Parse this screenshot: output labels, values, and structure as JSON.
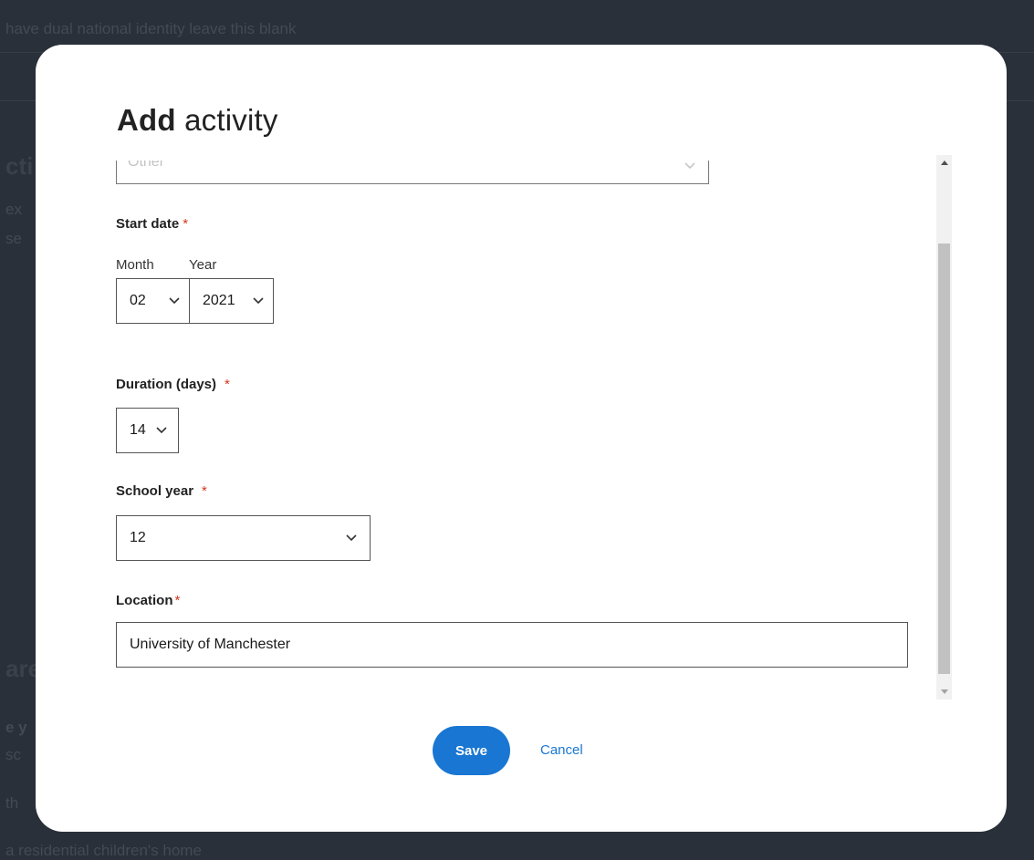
{
  "background": {
    "hint_text": "have dual national identity leave this blank",
    "heading_1": "cti",
    "line_1": "ex",
    "line_2": "se",
    "heading_2": "are",
    "line_3": "e y",
    "line_4": "sc",
    "line_5": "th",
    "line_6": "a residential children's home"
  },
  "modal": {
    "title_bold": "Add",
    "title_rest": " activity",
    "activity_type": {
      "value": "Other"
    },
    "start_date": {
      "label": "Start date",
      "required_marker": "*",
      "month_label": "Month",
      "year_label": "Year",
      "month_value": "02",
      "year_value": "2021"
    },
    "duration": {
      "label": "Duration (days)",
      "required_marker": "*",
      "value": "14"
    },
    "school_year": {
      "label": "School year",
      "required_marker": "*",
      "value": "12"
    },
    "location": {
      "label": "Location",
      "required_marker": "*",
      "value": "University of Manchester"
    },
    "save_label": "Save",
    "cancel_label": "Cancel"
  },
  "colors": {
    "overlay": "#2a3039",
    "accent": "#1976d2",
    "required": "#d4351c"
  }
}
